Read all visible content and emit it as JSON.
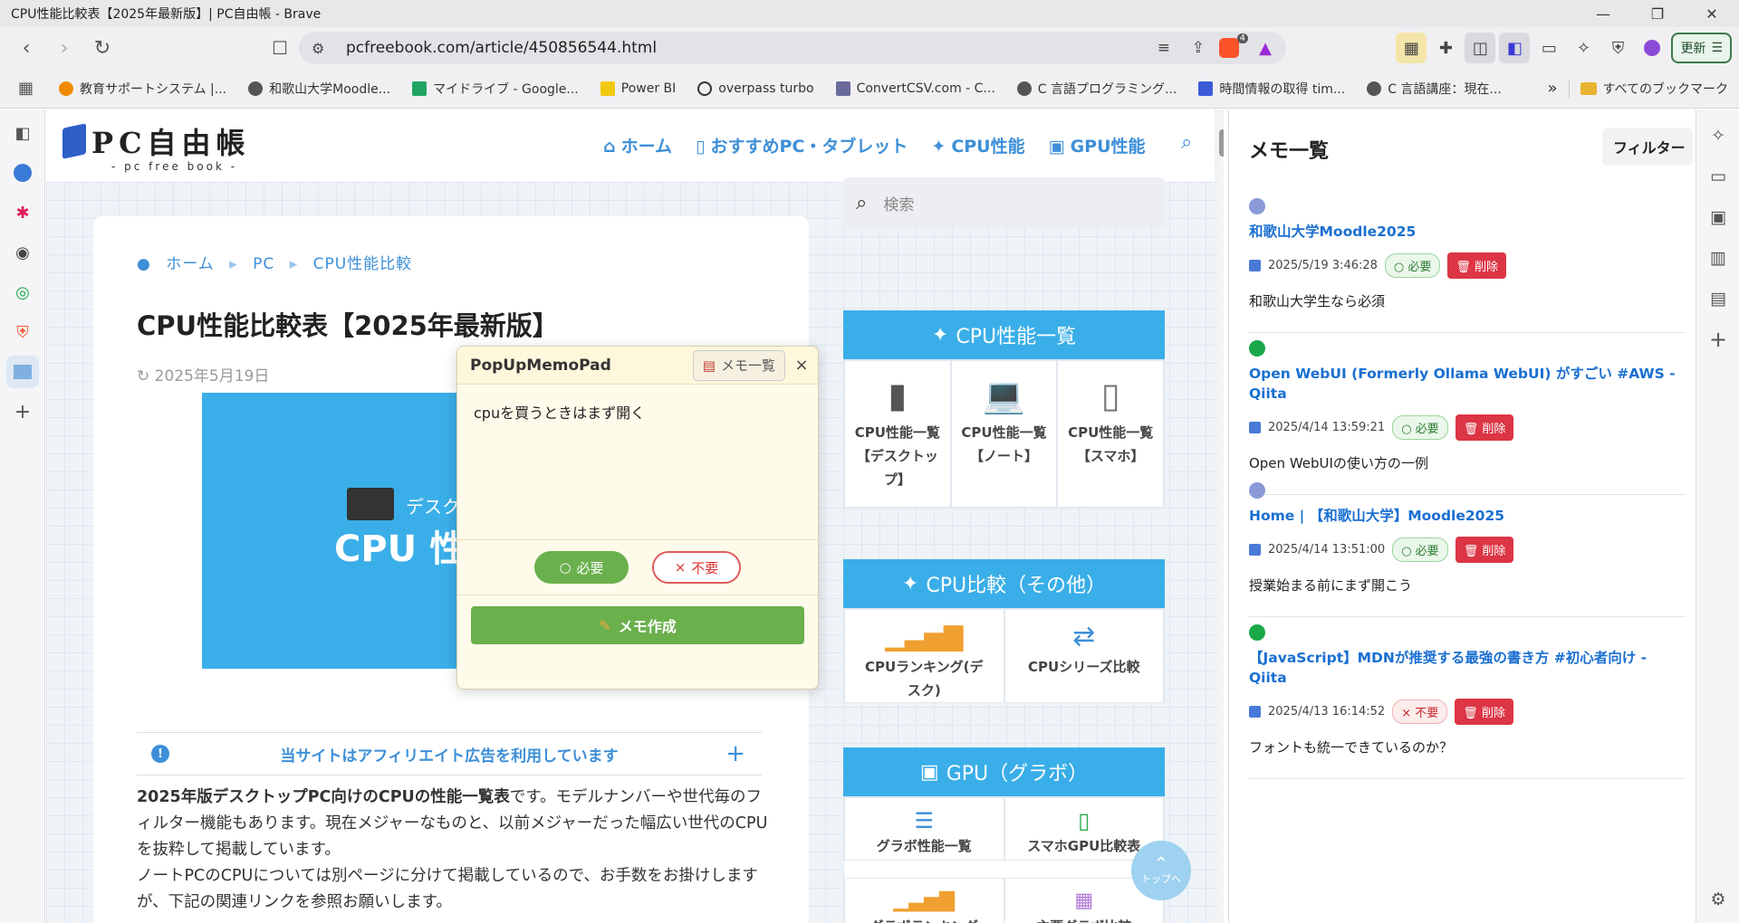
{
  "window": {
    "title": "CPU性能比較表【2025年最新版】| PC自由帳 - Brave",
    "minimize": "—",
    "restore": "❐",
    "close": "✕"
  },
  "toolbar": {
    "url": "pcfreebook.com/article/450856544.html",
    "brave_badge": "4",
    "update_label": "更新"
  },
  "bookmarks": [
    {
      "label": "教育サポートシステム |...",
      "color": "#f08a00"
    },
    {
      "label": "和歌山大学Moodle...",
      "color": "#555"
    },
    {
      "label": "マイドライブ - Google...",
      "color": "#1fa463"
    },
    {
      "label": "Power BI",
      "color": "#f2c811"
    },
    {
      "label": "overpass turbo",
      "color": "#333"
    },
    {
      "label": "ConvertCSV.com - C...",
      "color": "#6a6a9a"
    },
    {
      "label": "C 言語プログラミング...",
      "color": "#555"
    },
    {
      "label": "時間情報の取得 tim...",
      "color": "#3a5ad8"
    },
    {
      "label": "C 言語講座：現在...",
      "color": "#555"
    }
  ],
  "bookmarks_more": "»",
  "bookmarks_folder": "すべてのブックマーク",
  "site": {
    "logo_main": "PC自由帳",
    "logo_sub": "- pc free book -",
    "nav": [
      {
        "icon": "⌂",
        "label": "ホーム"
      },
      {
        "icon": "▯",
        "label": "おすすめPC・タブレット"
      },
      {
        "icon": "✦",
        "label": "CPU性能"
      },
      {
        "icon": "▣",
        "label": "GPU性能"
      }
    ],
    "breadcrumb": [
      "ホーム",
      "PC",
      "CPU性能比較"
    ],
    "breadcrumb_sep": "▸",
    "title": "CPU性能比較表【2025年最新版】",
    "date": "2025年5月19日",
    "hero_line1": "デスク",
    "hero_line2": "CPU 性能",
    "affiliate": "当サイトはアフィリエイト広告を利用しています",
    "body_p1_bold": "2025年版デスクトップPC向けのCPUの性能一覧表",
    "body_p1_rest": "です。モデルナンバーや世代毎のフィルター機能もあります。現在メジャーなものと、以前メジャーだった幅広い世代のCPUを抜粋して掲載しています。",
    "body_p2": "ノートPCのCPUについては別ページに分けて掲載しているので、お手数をお掛けしますが、下記の関連リンクを参照お願いします。",
    "search_placeholder": "検索",
    "widgets": {
      "cpu_list": {
        "title": "CPU性能一覧",
        "items": [
          "CPU性能一覧【デスクトップ】",
          "CPU性能一覧【ノート】",
          "CPU性能一覧【スマホ】"
        ]
      },
      "cpu_compare": {
        "title": "CPU比較（その他）",
        "items": [
          "CPUランキング(デスク)",
          "CPUシリーズ比較"
        ]
      },
      "gpu": {
        "title": "GPU（グラボ）",
        "items": [
          "グラボ性能一覧",
          "スマホGPU比較表",
          "グラボランキング",
          "主要グラボ比較"
        ]
      }
    },
    "totop": "トップへ"
  },
  "popup": {
    "title": "PopUpMemoPad",
    "memo_list_button": "メモ一覧",
    "close": "×",
    "memo_text": "cpuを買うときはまず開く",
    "need_label": "必要",
    "noneed_label": "不要",
    "create_label": "メモ作成"
  },
  "memo_panel": {
    "title": "メモ一覧",
    "filter": "フィルター",
    "items": [
      {
        "title": "和歌山大学Moodle2025",
        "date": "2025/5/19 3:46:28",
        "tag": "必要",
        "tag_type": "need",
        "delete": "削除",
        "text": "和歌山大学生なら必須",
        "ico": "#8a9ad8"
      },
      {
        "title": "Open WebUI (Formerly Ollama WebUI) がすごい #AWS - Qiita",
        "date": "2025/4/14 13:59:21",
        "tag": "必要",
        "tag_type": "need",
        "delete": "削除",
        "text": "Open WebUIの使い方の一例",
        "ico": "#55c500"
      },
      {
        "title": "Home | 【和歌山大学】Moodle2025",
        "date": "2025/4/14 13:51:00",
        "tag": "必要",
        "tag_type": "need",
        "delete": "削除",
        "text": "授業始まる前にまず開こう",
        "ico": "#8a9ad8"
      },
      {
        "title": "【JavaScript】MDNが推奨する最強の書き方 #初心者向け - Qiita",
        "date": "2025/4/13 16:14:52",
        "tag": "不要",
        "tag_type": "noneed",
        "delete": "削除",
        "text": "フォントも統一できているのか？",
        "ico": "#55c500"
      }
    ]
  }
}
